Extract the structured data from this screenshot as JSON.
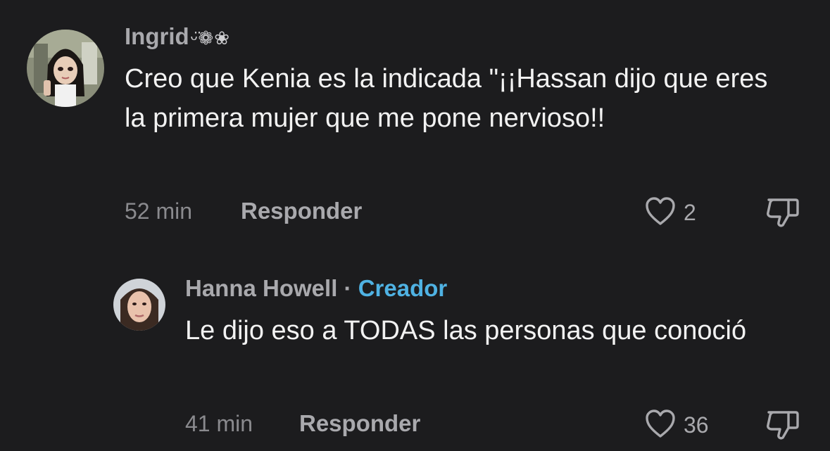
{
  "comments": [
    {
      "username": "Ingrid",
      "username_deco": "ᵕ̈❁❀",
      "text": "Creo que Kenia es la indicada \"¡¡Hassan dijo que eres la primera mujer que me pone nervioso!!",
      "time": "52 min",
      "reply_label": "Responder",
      "likes": "2"
    },
    {
      "username": "Hanna Howell",
      "separator": "·",
      "badge": "Creador",
      "text": "Le dijo eso a TODAS las personas que conoció",
      "time": "41 min",
      "reply_label": "Responder",
      "likes": "36"
    }
  ],
  "icons": {
    "like": "heart-outline-icon",
    "dislike": "thumbs-down-icon"
  },
  "colors": {
    "background": "#1c1c1e",
    "creator_badge": "#4fb2e3",
    "secondary_text": "#a9a9ad"
  }
}
